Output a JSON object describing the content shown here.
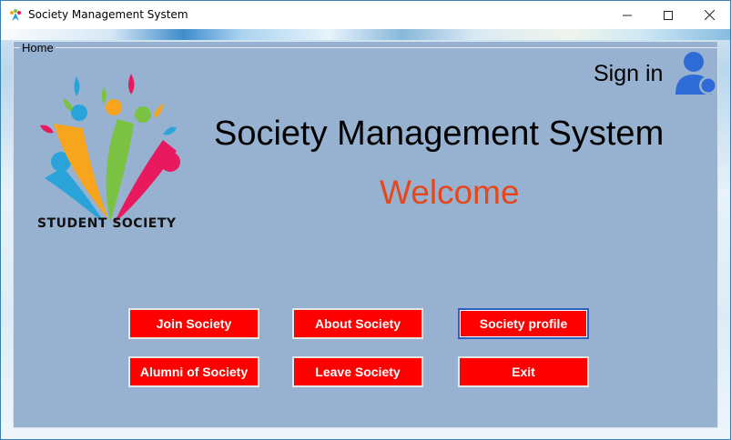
{
  "window": {
    "title": "Society Management System"
  },
  "groupbox": {
    "label": "Home"
  },
  "logo": {
    "text": "STUDENT SOCIETY",
    "colors": [
      "#e8195e",
      "#2aa4d8",
      "#7cc242",
      "#f7a51c"
    ]
  },
  "header": {
    "signin_label": "Sign in",
    "title": "Society Management System",
    "welcome": "Welcome"
  },
  "buttons": {
    "join": "Join Society",
    "about": "About Society",
    "profile": "Society profile",
    "alumni": "Alumni of Society",
    "leave": "Leave Society",
    "exit": "Exit"
  },
  "colors": {
    "button_bg": "#ff0000",
    "panel_bg": "#97b2d0",
    "welcome": "#e5461a",
    "user_icon": "#2f6bd6"
  }
}
